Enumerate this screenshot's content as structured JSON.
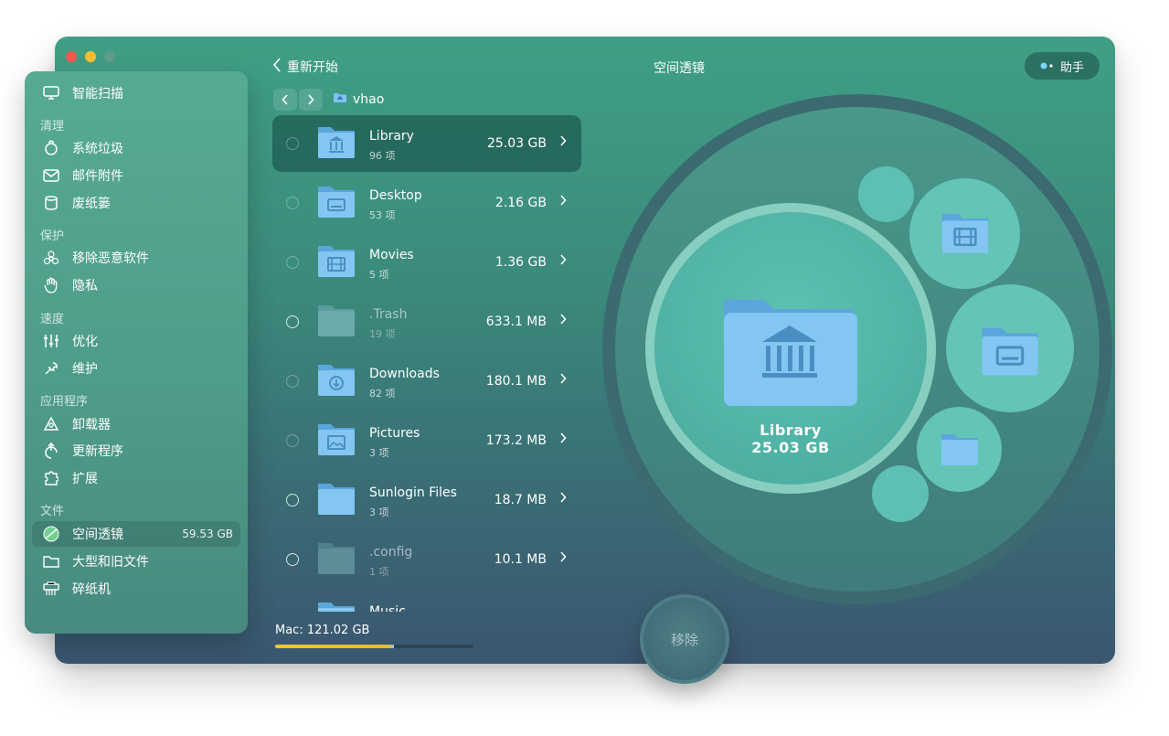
{
  "window": {
    "title": "空间透镜",
    "back_label": "重新开始",
    "assistant_label": "助手"
  },
  "traffic_lights": {
    "close": "#f2574e",
    "minimize": "#f6bc2f",
    "zoom": "#5f9b86"
  },
  "sidebar": {
    "smart_scan": "智能扫描",
    "sections": {
      "clean": "清理",
      "protect": "保护",
      "speed": "速度",
      "apps": "应用程序",
      "files": "文件"
    },
    "items": {
      "system_junk": "系统垃圾",
      "mail_attachments": "邮件附件",
      "trash_bins": "废纸篓",
      "malware_removal": "移除恶意软件",
      "privacy": "隐私",
      "optimization": "优化",
      "maintenance": "维护",
      "uninstaller": "卸载器",
      "updater": "更新程序",
      "extensions": "扩展",
      "space_lens": "空间透镜",
      "space_lens_value": "59.53 GB",
      "large_old_files": "大型和旧文件",
      "shredder": "碎纸机"
    }
  },
  "breadcrumb": {
    "folder": "vhao"
  },
  "files": [
    {
      "name": "Library",
      "count": "96 项",
      "size": "25.03 GB",
      "selected": true
    },
    {
      "name": "Desktop",
      "count": "53 项",
      "size": "2.16 GB"
    },
    {
      "name": "Movies",
      "count": "5 项",
      "size": "1.36 GB"
    },
    {
      "name": ".Trash",
      "count": "19 项",
      "size": "633.1 MB"
    },
    {
      "name": "Downloads",
      "count": "82 项",
      "size": "180.1 MB"
    },
    {
      "name": "Pictures",
      "count": "3 项",
      "size": "173.2 MB"
    },
    {
      "name": "Sunlogin Files",
      "count": "3 项",
      "size": "18.7 MB"
    },
    {
      "name": ".config",
      "count": "1 项",
      "size": "10.1 MB"
    },
    {
      "name": "Music",
      "count": "",
      "size": ""
    }
  ],
  "storage": {
    "label": "Mac: 121.02 GB",
    "used_fraction": 0.58,
    "selected_fraction": 0.02
  },
  "bubble_view": {
    "title": "Library",
    "size": "25.03 GB"
  },
  "remove_button": "移除",
  "colors": {
    "accent_yellow": "#f1c534",
    "folder_blue": "#7cc2f2"
  }
}
